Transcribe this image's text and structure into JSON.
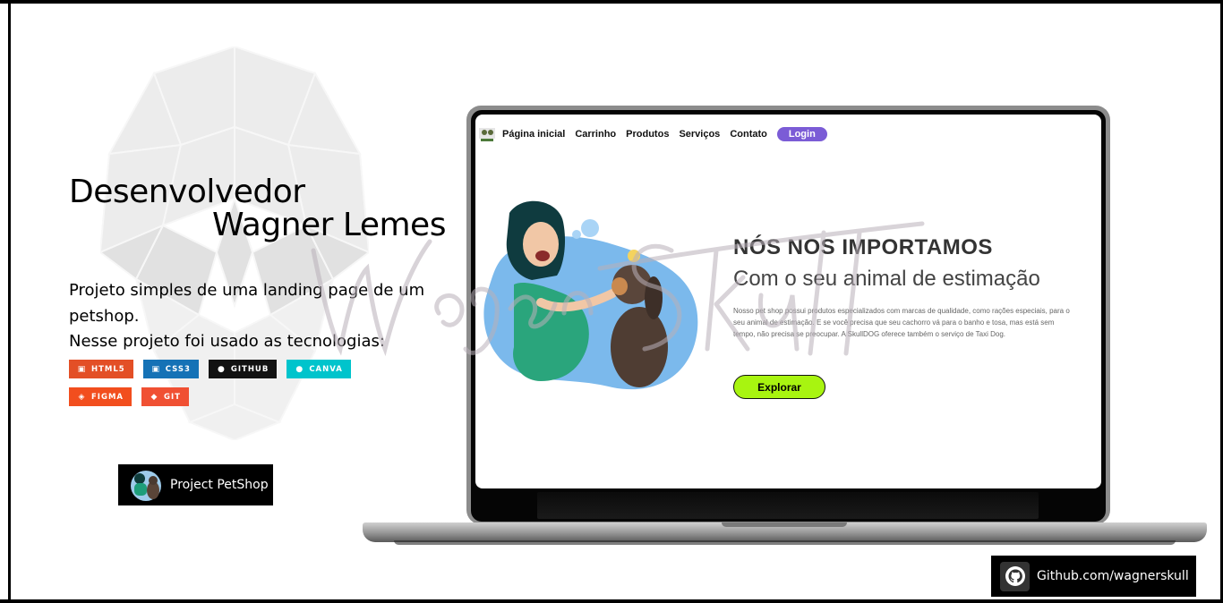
{
  "hero": {
    "title_line1": "Desenvolvedor",
    "title_line2": "Wagner Lemes",
    "desc_line1": "Projeto simples de uma landing page de um petshop.",
    "desc_line2": "Nesse projeto foi usado as tecnologias:"
  },
  "badges": [
    {
      "label": "HTML5",
      "icon": "html5-icon",
      "color": "#e34f26"
    },
    {
      "label": "CSS3",
      "icon": "css3-icon",
      "color": "#1572b6"
    },
    {
      "label": "GITHUB",
      "icon": "github-icon",
      "color": "#121212"
    },
    {
      "label": "CANVA",
      "icon": "canva-icon",
      "color": "#00c4cc"
    },
    {
      "label": "FIGMA",
      "icon": "figma-icon",
      "color": "#f24e1e"
    },
    {
      "label": "GIT",
      "icon": "git-icon",
      "color": "#f05033"
    }
  ],
  "project_button": {
    "label": "Project PetShop"
  },
  "github_button": {
    "label": "Github.com/wagnerskull"
  },
  "preview": {
    "nav": {
      "items": [
        "Página inicial",
        "Carrinho",
        "Produtos",
        "Serviços",
        "Contato"
      ],
      "login": "Login"
    },
    "headline": "NÓS NOS IMPORTAMOS",
    "subheadline": "Com o seu animal de estimação",
    "body": "Nosso pet shop possui produtos especializados com marcas de qualidade, como rações especiais, para o seu animal de estimação. E se você precisa que seu cachorro vá para o banho e tosa, mas está sem tempo, não precisa se preocupar. A SkullDOG oferece também o serviço de Taxi Dog.",
    "cta": "Explorar",
    "accent": "#7b5cd6",
    "cta_color": "#a8f410"
  }
}
